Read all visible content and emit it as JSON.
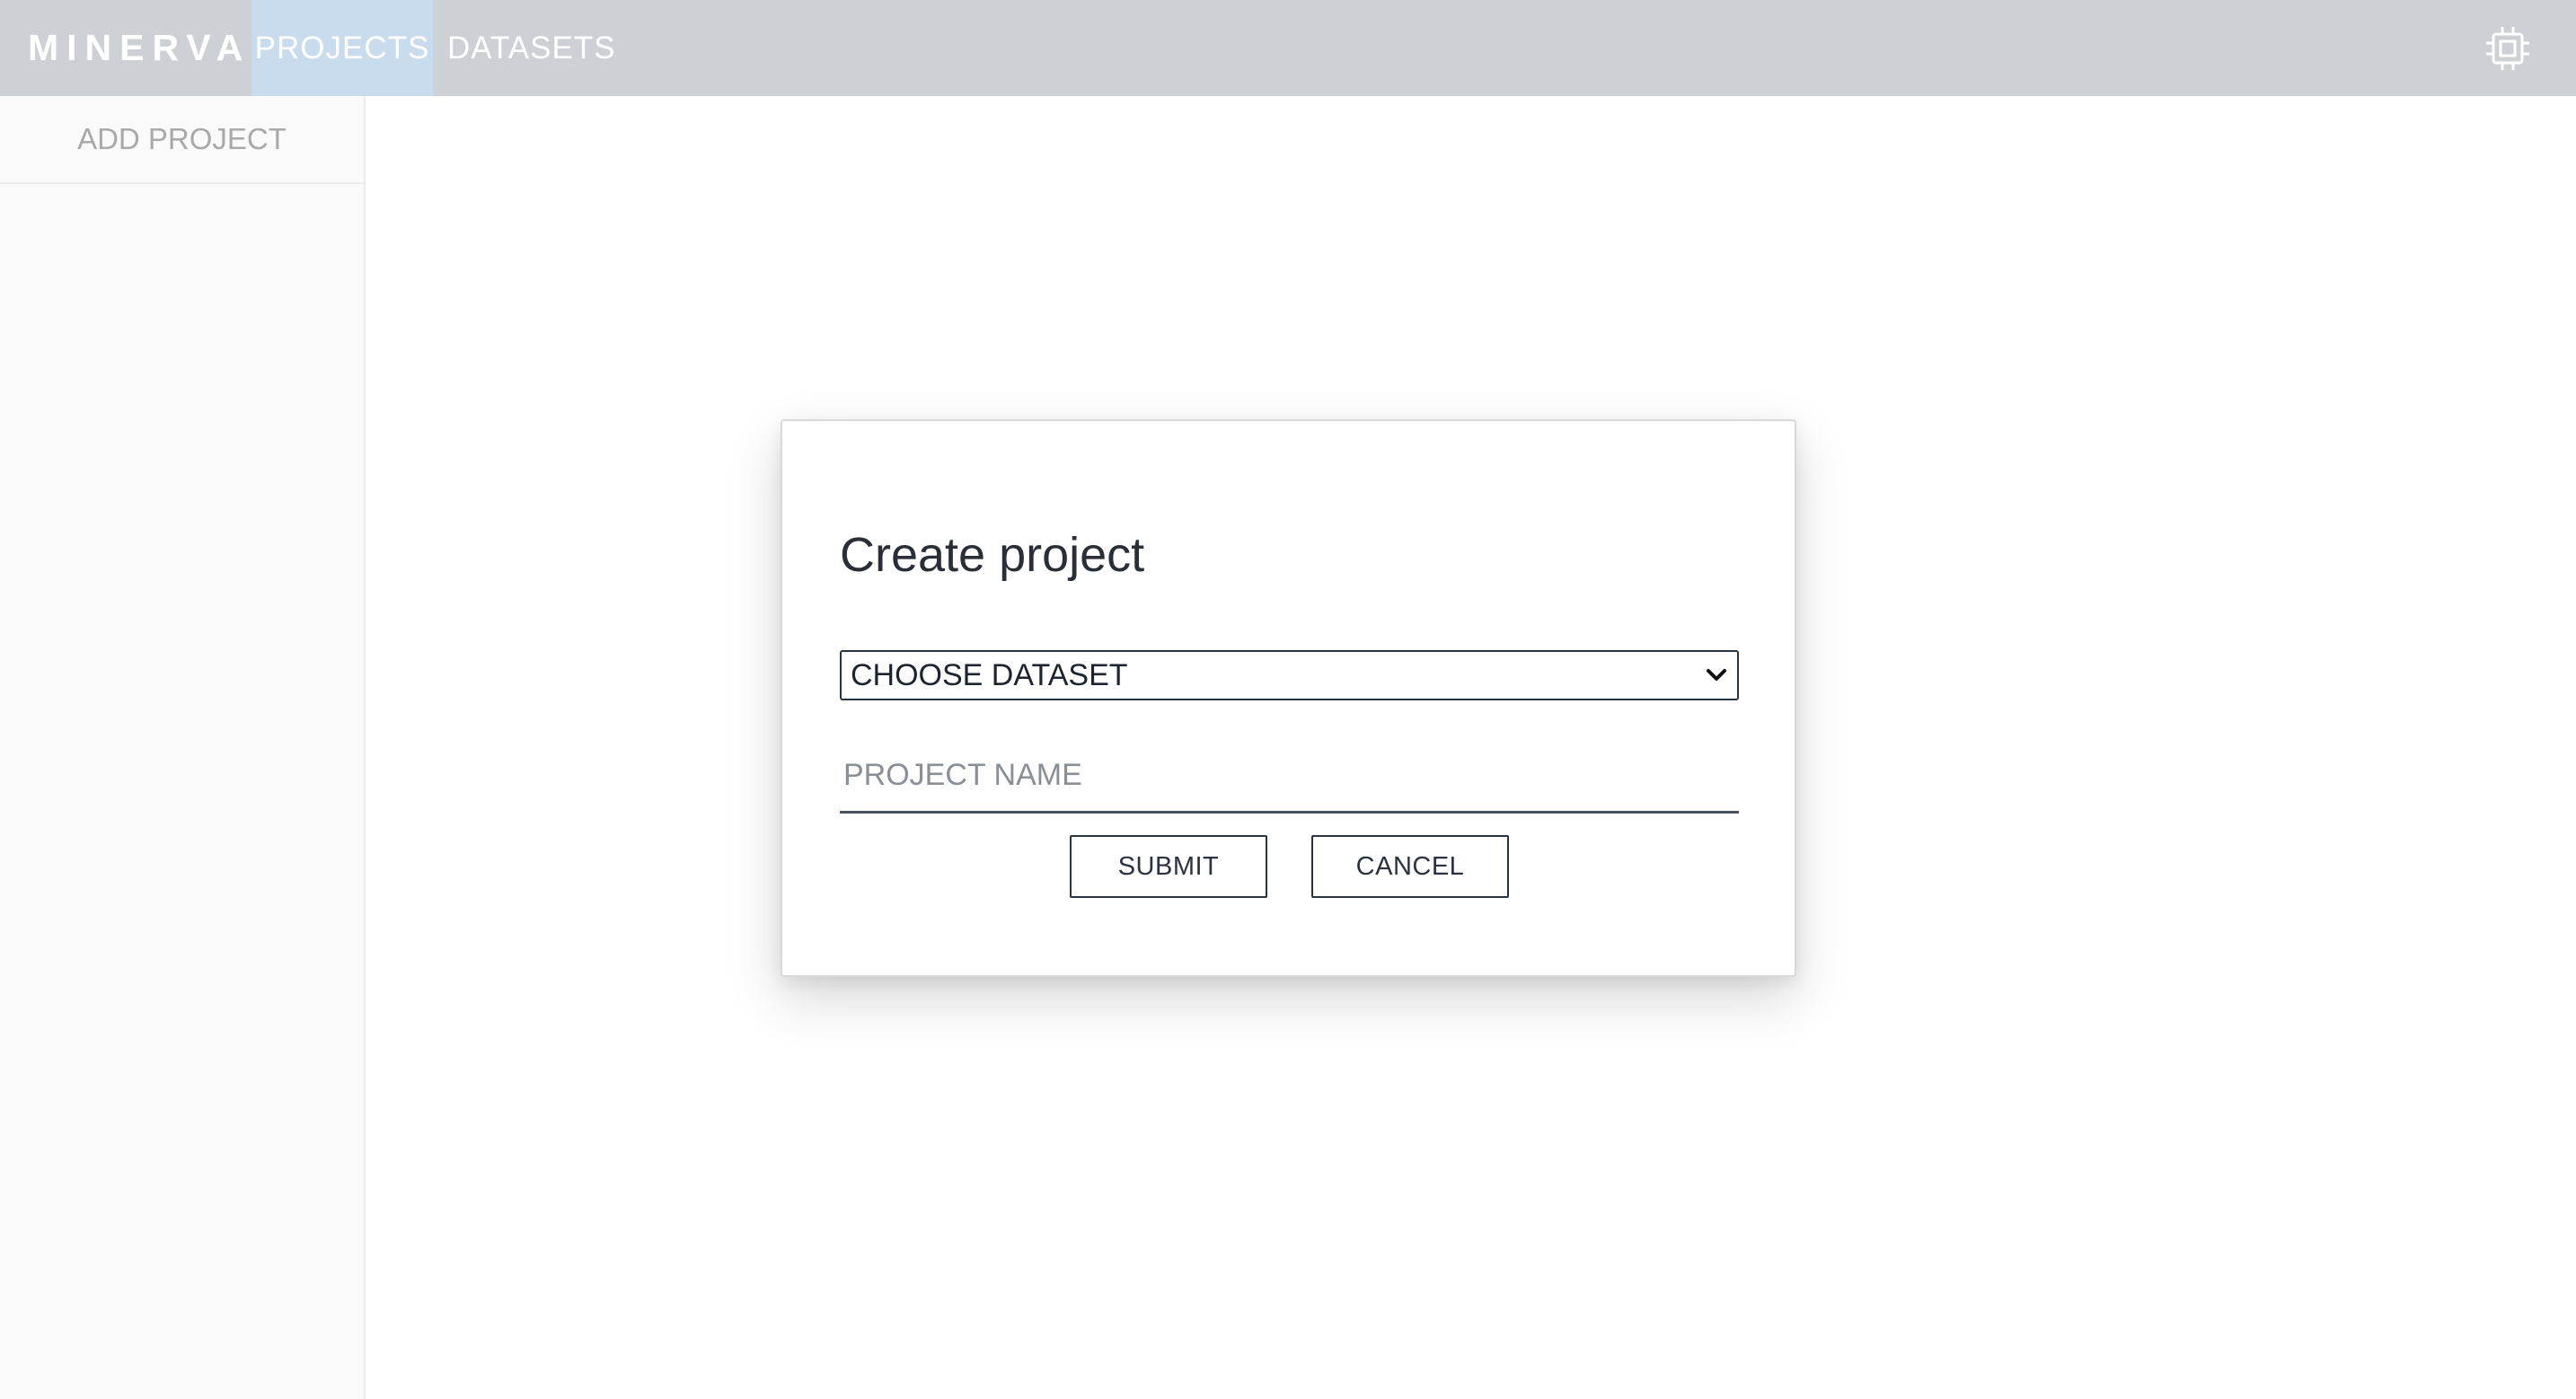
{
  "header": {
    "brand": "MINERVA",
    "tabs": [
      {
        "label": "PROJECTS",
        "active": true
      },
      {
        "label": "DATASETS",
        "active": false
      }
    ],
    "settings_icon": "cpu-chip-icon"
  },
  "sidebar": {
    "add_project_label": "ADD PROJECT"
  },
  "modal": {
    "title": "Create project",
    "dataset_select": {
      "selected": "CHOOSE DATASET",
      "icon": "chevron-down-icon"
    },
    "project_name": {
      "value": "",
      "placeholder": "PROJECT NAME"
    },
    "submit_label": "SUBMIT",
    "cancel_label": "CANCEL"
  },
  "colors": {
    "topbar": "#cdd1d6",
    "active_tab": "#c8dced",
    "sidebar": "#fafafa",
    "text_dark": "#2b3340"
  }
}
